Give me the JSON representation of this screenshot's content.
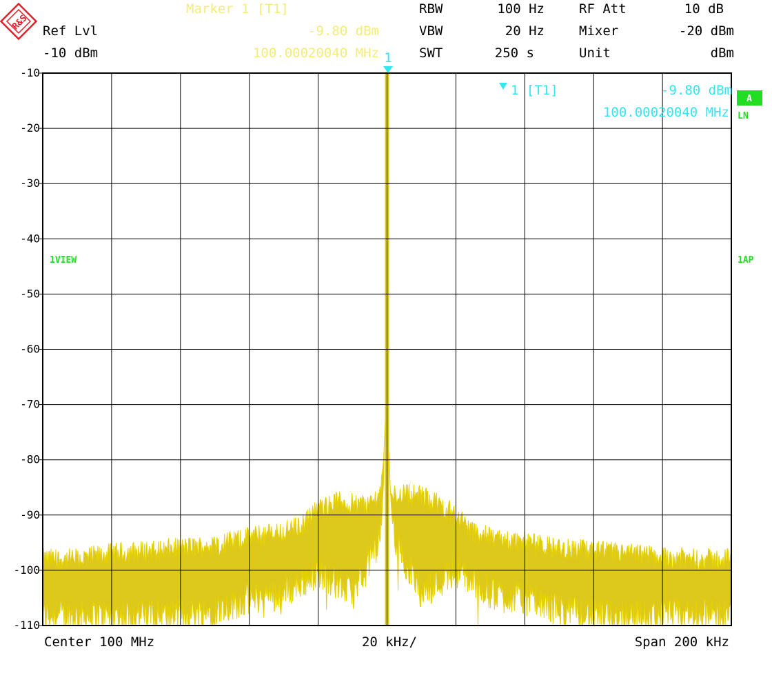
{
  "header": {
    "ref_lvl_label": "Ref Lvl",
    "ref_lvl_value": "-10 dBm",
    "marker_title": "Marker 1 [T1]",
    "marker_level": "-9.80 dBm",
    "marker_freq": "100.00020040 MHz",
    "rbw_label": "RBW",
    "rbw_value": "100 Hz",
    "vbw_label": "VBW",
    "vbw_value": "20 Hz",
    "swt_label": "SWT",
    "swt_value": "250 s",
    "rfatt_label": "RF Att",
    "rfatt_value": "10 dB",
    "mixer_label": "Mixer",
    "mixer_value": "-20 dBm",
    "unit_label": "Unit",
    "unit_value": "dBm"
  },
  "logo_text": "R&S",
  "side_labels": {
    "view": "1VIEW",
    "ap": "1AP",
    "a_badge": "A",
    "ln": "LN"
  },
  "marker_box": {
    "marker_number": "1",
    "label": "1 [T1]",
    "level": "-9.80 dBm",
    "freq": "100.00020040 MHz"
  },
  "footer": {
    "center": "Center 100 MHz",
    "div": "20 kHz/",
    "span": "Span 200 kHz"
  },
  "colors": {
    "trace": "#e6d200",
    "trace_fill": "#ddc81c",
    "marker": "#33e6f0",
    "header_marker": "#f4ec7a",
    "green": "#22dd22",
    "grid": "#000000",
    "logo": "#e0202a"
  },
  "chart_data": {
    "type": "line",
    "title": "",
    "xlabel": "",
    "ylabel": "",
    "x_unit": "kHz offset from 100 MHz",
    "xlim": [
      -100,
      100
    ],
    "ylim": [
      -110,
      -10
    ],
    "y_ticks": [
      -10,
      -20,
      -30,
      -40,
      -50,
      -60,
      -70,
      -80,
      -90,
      -100,
      -110
    ],
    "grid": true,
    "series": [
      {
        "upper_envelope": {
          "x": [
            -100,
            -90,
            -80,
            -70,
            -60,
            -50,
            -40,
            -30,
            -25,
            -20,
            -15,
            -10,
            -5,
            -2,
            -1,
            -0.3,
            0,
            0.3,
            1,
            2,
            5,
            10,
            15,
            20,
            25,
            30,
            40,
            50,
            60,
            70,
            80,
            90,
            100
          ],
          "y": [
            -98,
            -98,
            -97,
            -96.5,
            -96,
            -95.5,
            -94,
            -93,
            -92,
            -89,
            -87.5,
            -88,
            -88,
            -86,
            -80,
            -70,
            -9.8,
            -75,
            -86,
            -86.5,
            -86,
            -86.5,
            -88,
            -90,
            -93,
            -94,
            -95,
            -96,
            -96.5,
            -97,
            -97.5,
            -98,
            -98
          ]
        },
        "lower_envelope": {
          "x": [
            -100,
            -90,
            -80,
            -70,
            -60,
            -50,
            -40,
            -30,
            -25,
            -20,
            -15,
            -10,
            -5,
            -2,
            -1,
            0,
            1,
            2,
            5,
            10,
            15,
            20,
            25,
            30,
            40,
            50,
            60,
            70,
            80,
            90,
            100
          ],
          "y": [
            -110,
            -110,
            -110,
            -110,
            -110,
            -109,
            -107,
            -106,
            -104,
            -102,
            -104,
            -106,
            -100,
            -96,
            -84,
            -9.8,
            -86,
            -96,
            -100,
            -106,
            -104,
            -102,
            -104,
            -106,
            -107,
            -109,
            -110,
            -110,
            -110,
            -110,
            -110
          ]
        }
      }
    ],
    "marker": {
      "x_khz": 0.2004,
      "y_dbm": -9.8
    }
  }
}
